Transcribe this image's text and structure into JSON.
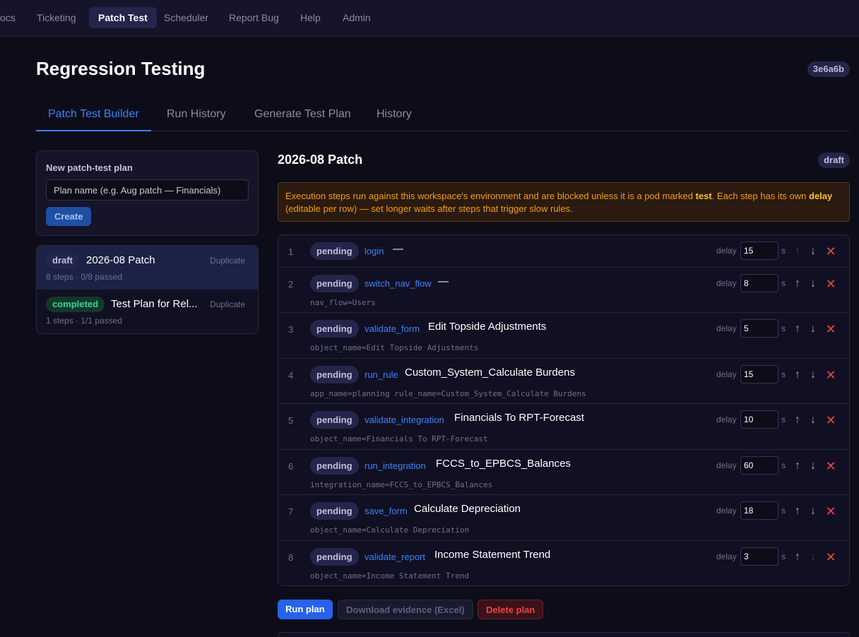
{
  "nav": {
    "items": [
      {
        "label": "ocs",
        "active": false
      },
      {
        "label": "Ticketing",
        "active": false
      },
      {
        "label": "Patch Test",
        "active": true
      },
      {
        "label": "Scheduler",
        "active": false
      },
      {
        "label": "Report Bug",
        "active": false
      },
      {
        "label": "Help",
        "active": false
      },
      {
        "label": "Admin",
        "active": false
      }
    ]
  },
  "page": {
    "title": "Regression Testing",
    "hash": "3e6a6b"
  },
  "tabs": [
    {
      "label": "Patch Test Builder",
      "active": true
    },
    {
      "label": "Run History",
      "active": false
    },
    {
      "label": "Generate Test Plan",
      "active": false
    },
    {
      "label": "History",
      "active": false
    }
  ],
  "new_plan": {
    "label": "New patch-test plan",
    "placeholder": "Plan name (e.g. Aug patch — Financials)",
    "create_label": "Create"
  },
  "plans": [
    {
      "status": "draft",
      "name": "2026-08 Patch",
      "duplicate": "Duplicate",
      "meta": "8 steps · 0/8 passed",
      "selected": true
    },
    {
      "status": "completed",
      "name": "Test Plan for Rel...",
      "duplicate": "Duplicate",
      "meta": "1 steps · 1/1 passed",
      "selected": false
    }
  ],
  "plan": {
    "title": "2026-08 Patch",
    "status": "draft",
    "warning": {
      "pre": "Execution steps run against this workspace's environment and are blocked unless it is a pod marked ",
      "test_word": "test",
      "mid": ". Each step has its own ",
      "delay_word": "delay",
      "post": " (editable per row) — set longer waits after steps that trigger slow rules."
    },
    "delay_label": "delay",
    "seconds_label": "s",
    "steps": [
      {
        "num": "1",
        "status": "pending",
        "action": "login",
        "target": "—",
        "params": "",
        "delay": "15",
        "up_enabled": false,
        "down_enabled": true
      },
      {
        "num": "2",
        "status": "pending",
        "action": "switch_nav_flow",
        "target": "—",
        "params": "nav_flow=Users",
        "delay": "8",
        "up_enabled": true,
        "down_enabled": true
      },
      {
        "num": "3",
        "status": "pending",
        "action": "validate_form",
        "target": "Edit Topside Adjustments",
        "params": "object_name=Edit Topside Adjustments",
        "delay": "5",
        "up_enabled": true,
        "down_enabled": true
      },
      {
        "num": "4",
        "status": "pending",
        "action": "run_rule",
        "target": "Custom_System_Calculate Burdens",
        "params": "app_name=planning rule_name=Custom_System_Calculate Burdens",
        "delay": "15",
        "up_enabled": true,
        "down_enabled": true
      },
      {
        "num": "5",
        "status": "pending",
        "action": "validate_integration",
        "target": "Financials To RPT-Forecast",
        "params": "object_name=Financials To RPT-Forecast",
        "delay": "10",
        "up_enabled": true,
        "down_enabled": true
      },
      {
        "num": "6",
        "status": "pending",
        "action": "run_integration",
        "target": "FCCS_to_EPBCS_Balances",
        "params": "integration_name=FCCS_to_EPBCS_Balances",
        "delay": "60",
        "up_enabled": true,
        "down_enabled": true
      },
      {
        "num": "7",
        "status": "pending",
        "action": "save_form",
        "target": "Calculate Depreciation",
        "params": "object_name=Calculate Depreciation",
        "delay": "18",
        "up_enabled": true,
        "down_enabled": true
      },
      {
        "num": "8",
        "status": "pending",
        "action": "validate_report",
        "target": "Income Statement Trend",
        "params": "object_name=Income Statement Trend",
        "delay": "3",
        "up_enabled": true,
        "down_enabled": false
      }
    ]
  },
  "actions": {
    "run_label": "Run plan",
    "download_label": "Download evidence (Excel)",
    "delete_label": "Delete plan"
  },
  "icons": {
    "up": "arrow-up-icon",
    "down": "arrow-down-icon",
    "delete": "close-icon"
  },
  "colors": {
    "accent": "#3b82f6",
    "success": "#34d399",
    "danger": "#ef4444",
    "warning": "#f59e0b"
  }
}
